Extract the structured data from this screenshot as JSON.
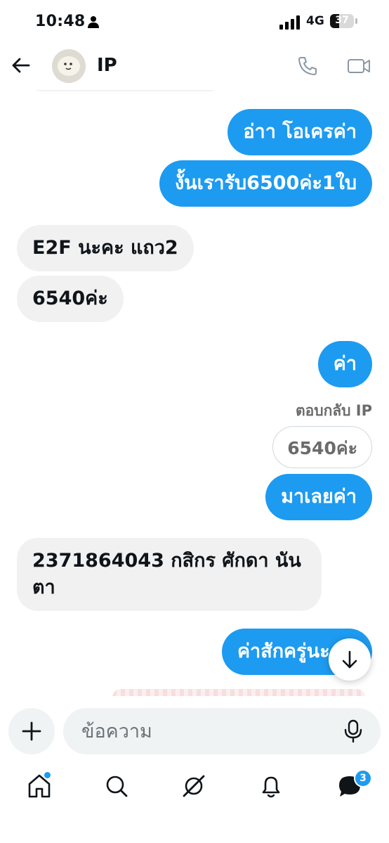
{
  "status_bar": {
    "time": "10:48",
    "network": "4G",
    "battery": "37",
    "battery_level": 0.37
  },
  "header": {
    "name": "IP"
  },
  "messages": [
    {
      "dir": "out",
      "text": "อ่าา โอเครค่า"
    },
    {
      "dir": "out",
      "text": "งั้นเรารับ6500ค่ะ1ใบ"
    },
    {
      "dir": "in",
      "text": "E2F นะคะ แถว2"
    },
    {
      "dir": "in",
      "text": "6540ค่ะ"
    },
    {
      "dir": "out",
      "text": "ค่า"
    },
    {
      "dir": "out",
      "text": "มาเลยค่า"
    },
    {
      "dir": "in",
      "text": "2371864043 กสิกร ศักดา นัน",
      "text2": "ตา"
    },
    {
      "dir": "out",
      "text": "ค่าสักครู่นะ"
    }
  ],
  "reply": {
    "label": "ตอบกลับ IP",
    "quoted": "6540ค่ะ"
  },
  "composer": {
    "placeholder": "ข้อความ"
  },
  "nav": {
    "messages_badge": "3"
  },
  "colors": {
    "accent": "#1d9bf0",
    "incoming_bubble": "#f1f1f1"
  }
}
